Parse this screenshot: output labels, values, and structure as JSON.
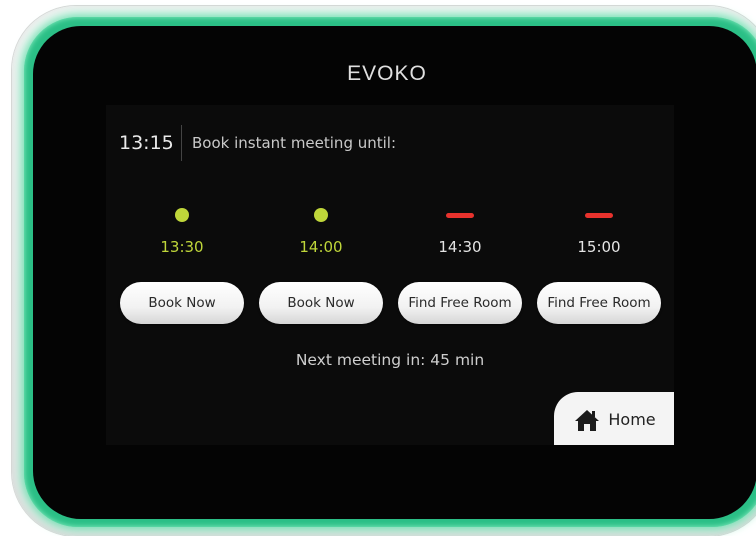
{
  "device": {
    "brand": "EVOKO",
    "accent_color": "#2bbf86"
  },
  "header": {
    "clock": "13:15",
    "prompt": "Book instant meeting until:"
  },
  "slots": [
    {
      "time": "13:30",
      "status": "free",
      "indicator_color": "#bfd63a",
      "button_label": "Book Now"
    },
    {
      "time": "14:00",
      "status": "free",
      "indicator_color": "#bfd63a",
      "button_label": "Book Now"
    },
    {
      "time": "14:30",
      "status": "busy",
      "indicator_color": "#e8322d",
      "button_label": "Find Free Room"
    },
    {
      "time": "15:00",
      "status": "busy",
      "indicator_color": "#e8322d",
      "button_label": "Find Free Room"
    }
  ],
  "next_meeting": "Next meeting in: 45 min",
  "home": {
    "icon": "home-icon",
    "label": "Home"
  }
}
